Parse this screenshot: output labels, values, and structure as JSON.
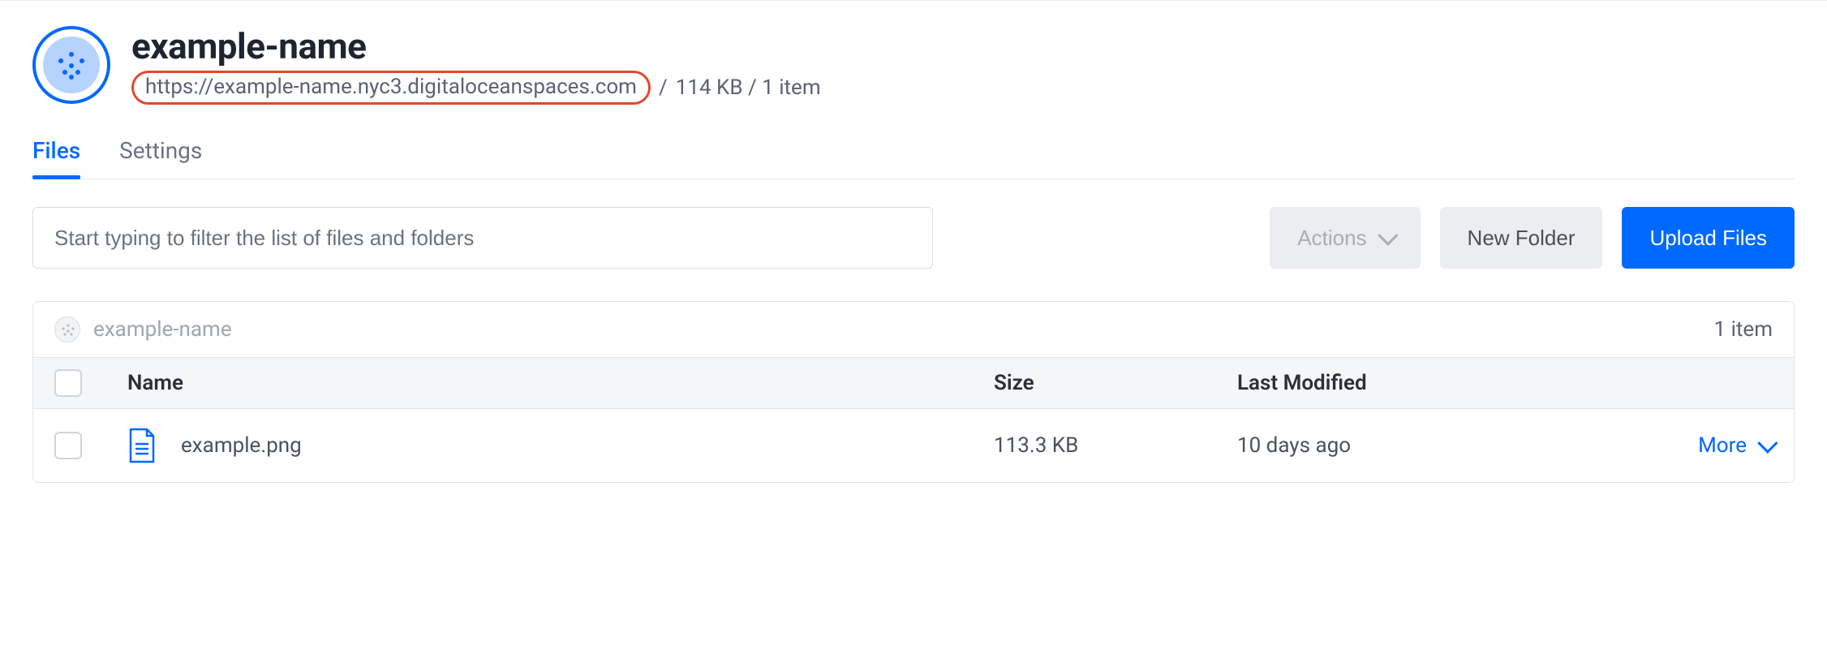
{
  "header": {
    "title": "example-name",
    "endpoint": "https://example-name.nyc3.digitaloceanspaces.com",
    "size_summary": "114 KB / 1 item",
    "separator": "/"
  },
  "tabs": {
    "files": "Files",
    "settings": "Settings"
  },
  "toolbar": {
    "filter_placeholder": "Start typing to filter the list of files and folders",
    "actions_label": "Actions",
    "new_folder_label": "New Folder",
    "upload_label": "Upload Files"
  },
  "breadcrumb": {
    "path": "example-name",
    "count": "1 item"
  },
  "columns": {
    "name": "Name",
    "size": "Size",
    "modified": "Last Modified"
  },
  "rows": [
    {
      "name": "example.png",
      "size": "113.3 KB",
      "modified": "10 days ago",
      "more_label": "More"
    }
  ]
}
